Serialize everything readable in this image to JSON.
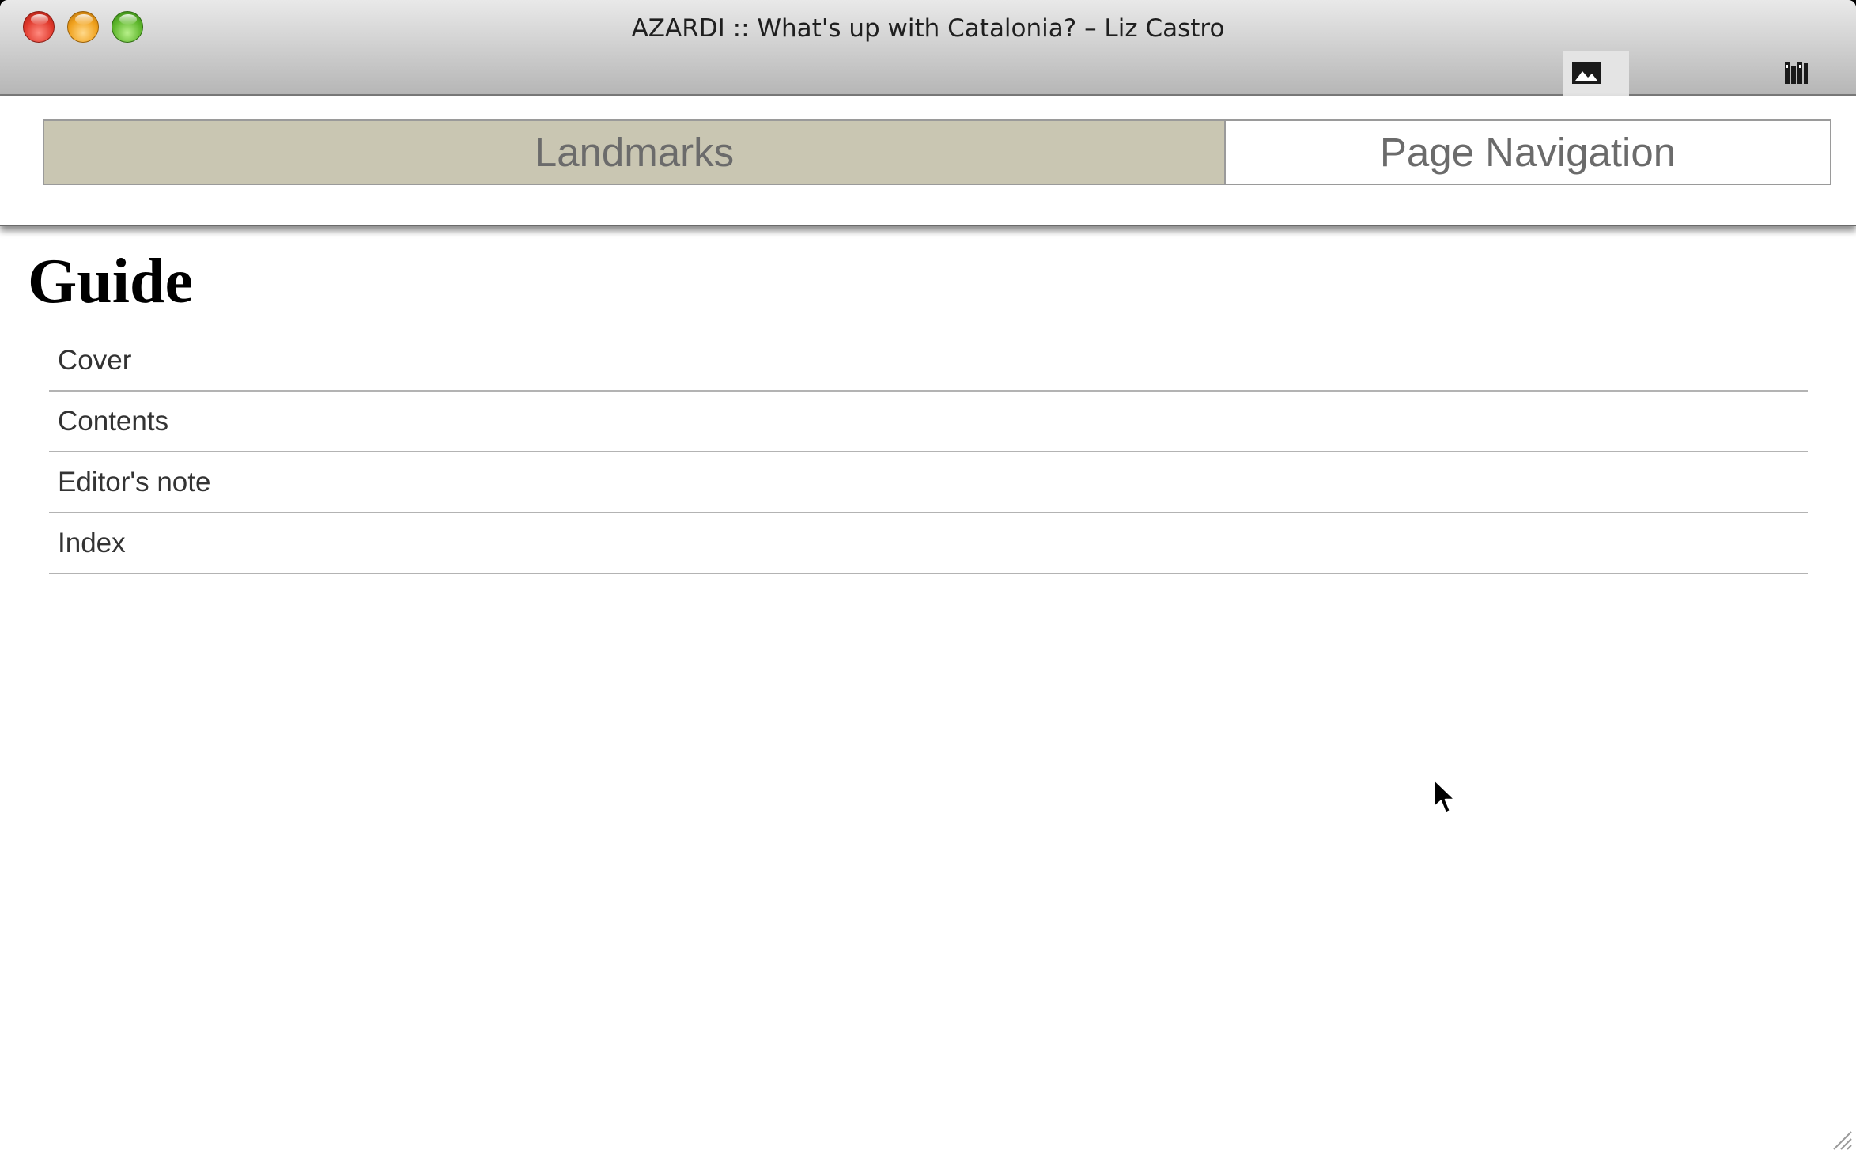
{
  "window": {
    "title": "AZARDI :: What's up with Catalonia? – Liz Castro"
  },
  "toolbar": {
    "buttons": [
      {
        "icon": "image-icon",
        "active": true
      },
      {
        "icon": "library-icon",
        "active": false
      }
    ]
  },
  "nav_tabs": [
    {
      "label": "Landmarks",
      "selected": true
    },
    {
      "label": "Page Navigation",
      "selected": false
    }
  ],
  "guide": {
    "title": "Guide",
    "items": [
      "Cover",
      "Contents",
      "Editor's note",
      "Index"
    ]
  },
  "colors": {
    "selected_tab": "#c9c6b2",
    "tab_text": "#6b6b6b",
    "item_divider": "#b3b3b3"
  }
}
